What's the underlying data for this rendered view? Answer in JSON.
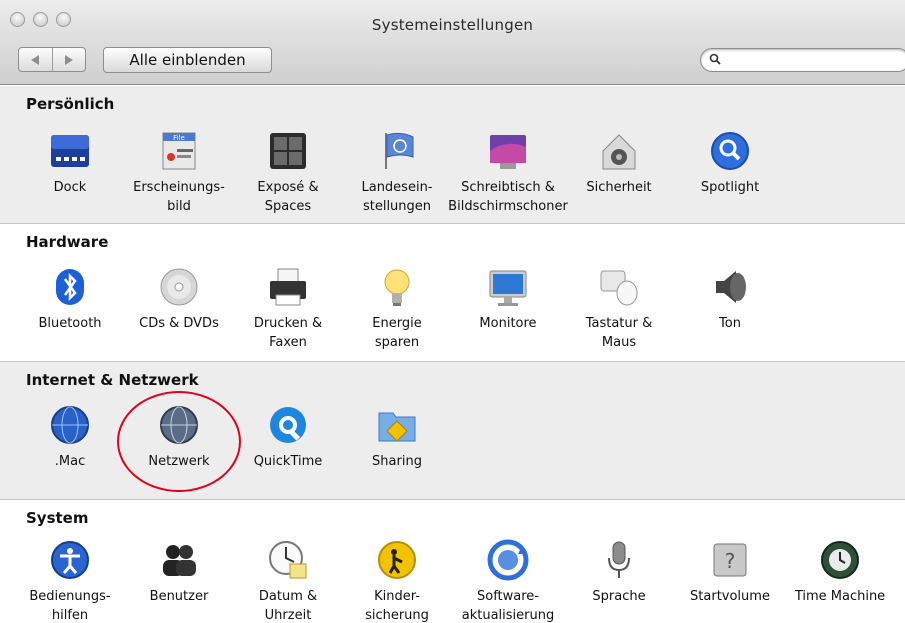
{
  "window": {
    "title": "Systemeinstellungen"
  },
  "toolbar": {
    "show_all_label": "Alle einblenden",
    "search_placeholder": ""
  },
  "sections": [
    {
      "title": "Persönlich",
      "items": [
        {
          "label": "Dock",
          "icon": "dock-icon"
        },
        {
          "label": "Erscheinungs-\nbild",
          "icon": "appearance-icon"
        },
        {
          "label": "Exposé &\nSpaces",
          "icon": "expose-spaces-icon"
        },
        {
          "label": "Landesein-\nstellungen",
          "icon": "international-icon"
        },
        {
          "label": "Schreibtisch &\nBildschirmschoner",
          "icon": "desktop-screensaver-icon"
        },
        {
          "label": "Sicherheit",
          "icon": "security-icon"
        },
        {
          "label": "Spotlight",
          "icon": "spotlight-icon"
        }
      ]
    },
    {
      "title": "Hardware",
      "items": [
        {
          "label": "Bluetooth",
          "icon": "bluetooth-icon"
        },
        {
          "label": "CDs & DVDs",
          "icon": "cd-dvd-icon"
        },
        {
          "label": "Drucken &\nFaxen",
          "icon": "printer-icon"
        },
        {
          "label": "Energie\nsparen",
          "icon": "energy-saver-icon"
        },
        {
          "label": "Monitore",
          "icon": "monitor-icon"
        },
        {
          "label": "Tastatur &\nMaus",
          "icon": "keyboard-mouse-icon"
        },
        {
          "label": "Ton",
          "icon": "speaker-icon"
        }
      ]
    },
    {
      "title": "Internet & Netzwerk",
      "items": [
        {
          "label": ".Mac",
          "icon": "dotmac-globe-icon"
        },
        {
          "label": "Netzwerk",
          "icon": "network-globe-icon"
        },
        {
          "label": "QuickTime",
          "icon": "quicktime-icon"
        },
        {
          "label": "Sharing",
          "icon": "sharing-folder-icon"
        }
      ]
    },
    {
      "title": "System",
      "items": [
        {
          "label": "Bedienungs-\nhilfen",
          "icon": "accessibility-icon"
        },
        {
          "label": "Benutzer",
          "icon": "users-icon"
        },
        {
          "label": "Datum &\nUhrzeit",
          "icon": "date-time-icon"
        },
        {
          "label": "Kinder-\nsicherung",
          "icon": "parental-controls-icon"
        },
        {
          "label": "Software-\naktualisierung",
          "icon": "software-update-icon"
        },
        {
          "label": "Sprache",
          "icon": "microphone-icon"
        },
        {
          "label": "Startvolume",
          "icon": "startup-disk-icon"
        },
        {
          "label": "Time Machine",
          "icon": "time-machine-icon"
        }
      ]
    }
  ],
  "colors": {
    "highlight_ring": "#e2001a",
    "accent_blue": "#1e5fcf"
  }
}
